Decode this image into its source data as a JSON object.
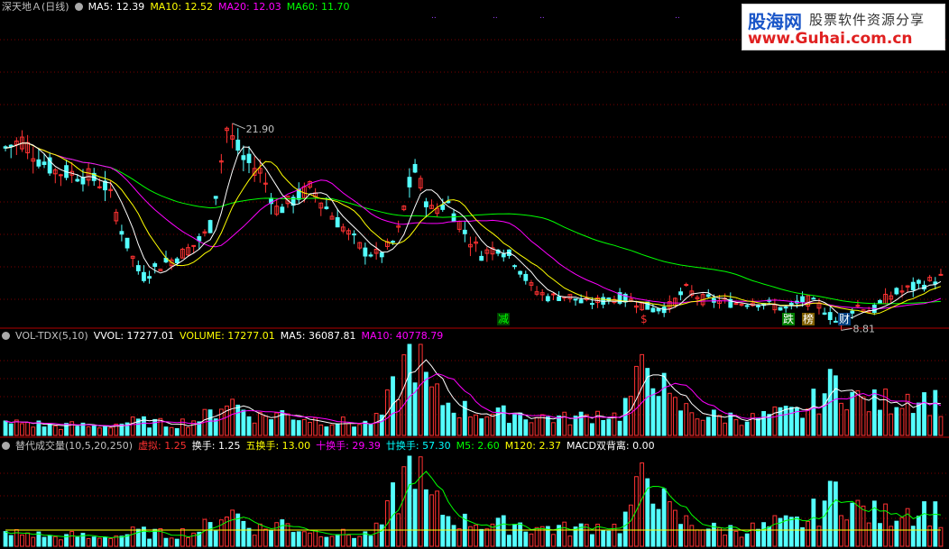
{
  "main_panel": {
    "title": "深天地Ａ(日线)",
    "ma_labels": [
      {
        "text": "MA5: 12.39",
        "color": "#ffffff"
      },
      {
        "text": "MA10: 12.52",
        "color": "#ffff00"
      },
      {
        "text": "MA20: 12.03",
        "color": "#ff00ff"
      },
      {
        "text": "MA60: 11.70",
        "color": "#00ff00"
      }
    ],
    "high_label": "21.90",
    "low_label": "8.81",
    "signals": [
      {
        "text": "减",
        "color": "#00ff00",
        "bg": "#004000"
      },
      {
        "text": "$",
        "color": "#ff3030",
        "bg": "#000000"
      },
      {
        "text": "跌",
        "color": "#ffffff",
        "bg": "#008000"
      },
      {
        "text": "榜",
        "color": "#ffffff",
        "bg": "#806000"
      },
      {
        "text": "财",
        "color": "#ffffff",
        "bg": "#004080"
      }
    ]
  },
  "volume_panel": {
    "title": "VOL-TDX(5,10)",
    "labels": [
      {
        "text": "VVOL: 17277.01",
        "color": "#ffffff"
      },
      {
        "text": "VOLUME: 17277.01",
        "color": "#ffff00"
      },
      {
        "text": "MA5: 36087.81",
        "color": "#ffffff"
      },
      {
        "text": "MA10: 40778.79",
        "color": "#ff00ff"
      }
    ]
  },
  "turnover_panel": {
    "title": "替代成交量(10,5,20,250)",
    "labels": [
      {
        "text": "虚拟: 1.25",
        "color": "#ff3030"
      },
      {
        "text": "换手: 1.25",
        "color": "#ffffff"
      },
      {
        "text": "五换手: 13.00",
        "color": "#ffff00"
      },
      {
        "text": "十换手: 29.39",
        "color": "#ff00ff"
      },
      {
        "text": "廿换手: 57.30",
        "color": "#00ffff"
      },
      {
        "text": "M5: 2.60",
        "color": "#00ff00"
      },
      {
        "text": "M120: 2.37",
        "color": "#ffff00"
      },
      {
        "text": "MACD双背离: 0.00",
        "color": "#ffffff"
      }
    ]
  },
  "logo": {
    "brand": "股海网",
    "tagline": "股票软件资源分享",
    "url": "www.Guhai.com.cn"
  },
  "colors": {
    "up": "#ff3232",
    "down": "#54ffff",
    "grid": "#7a0000",
    "separator": "#b00000"
  },
  "chart_data": {
    "type": "candlestick",
    "price_axis": {
      "ylim": [
        8,
        23.5
      ]
    },
    "anchors_close": [
      16.8,
      17.2,
      16.2,
      15.6,
      15.5,
      15.3,
      14.8,
      12.2,
      10.2,
      10.8,
      11.2,
      11.8,
      12.6,
      17.8,
      16.2,
      15.6,
      13.6,
      14.2,
      14.8,
      13.6,
      12.6,
      11.6,
      11.3,
      12.2,
      15.8,
      13.6,
      14.0,
      12.5,
      11.4,
      11.8,
      11.0,
      9.6,
      9.2,
      9.3,
      8.9,
      9.0,
      9.2,
      9.0,
      8.6,
      8.7,
      9.6,
      9.1,
      9.0,
      8.9,
      9.0,
      8.8,
      8.6,
      9.1,
      8.7,
      7.8,
      8.8,
      8.5,
      9.3,
      9.6,
      9.9,
      10.2
    ],
    "volume_anchors": [
      0.12,
      0.14,
      0.12,
      0.1,
      0.11,
      0.1,
      0.11,
      0.14,
      0.15,
      0.13,
      0.13,
      0.16,
      0.22,
      0.4,
      0.28,
      0.2,
      0.24,
      0.22,
      0.18,
      0.16,
      0.14,
      0.12,
      0.18,
      0.55,
      1.0,
      0.45,
      0.35,
      0.28,
      0.25,
      0.22,
      0.25,
      0.2,
      0.2,
      0.18,
      0.2,
      0.25,
      0.2,
      0.5,
      0.88,
      0.35,
      0.28,
      0.22,
      0.2,
      0.2,
      0.18,
      0.22,
      0.24,
      0.25,
      0.45,
      0.6,
      0.4,
      0.35,
      0.38,
      0.45,
      0.4,
      0.35
    ]
  }
}
